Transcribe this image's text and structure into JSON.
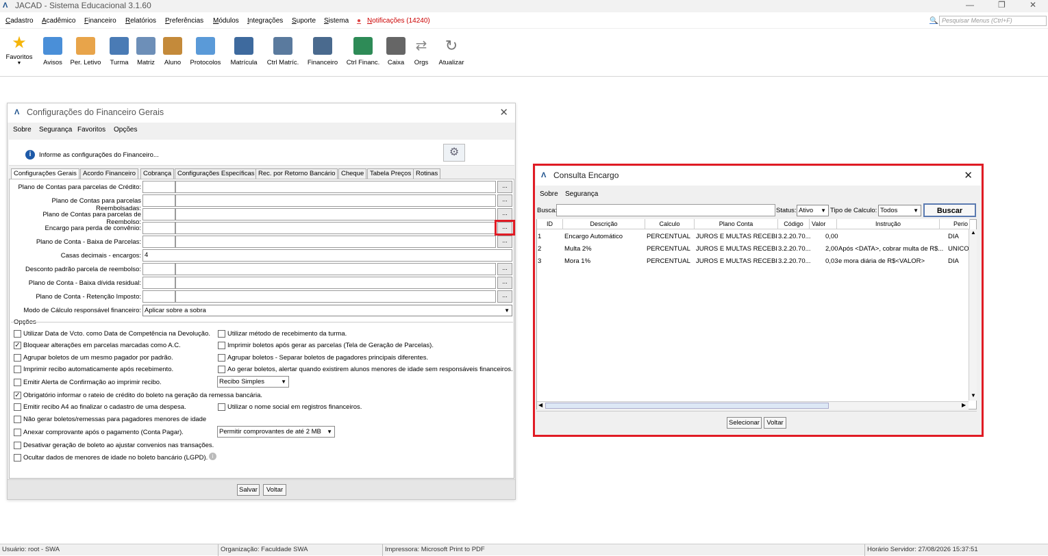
{
  "app": {
    "title": "JACAD - Sistema Educacional 3.1.60",
    "logo": "Λ"
  },
  "menubar": {
    "items": [
      "Cadastro",
      "Acadêmico",
      "Financeiro",
      "Relatórios",
      "Preferências",
      "Módulos",
      "Integrações",
      "Suporte",
      "Sistema"
    ],
    "notifications": "Notificações (14240)",
    "search_placeholder": "Pesquisar Menus (Ctrl+F)"
  },
  "toolbar": {
    "items": [
      "Favoritos",
      "Avisos",
      "Per. Letivo",
      "Turma",
      "Matriz",
      "Aluno",
      "Protocolos",
      "Matrícula",
      "Ctrl Matríc.",
      "Financeiro",
      "Ctrl Financ.",
      "Caixa",
      "Orgs",
      "Atualizar"
    ]
  },
  "config_window": {
    "title": "Configurações do Financeiro Gerais",
    "menu": [
      "Sobre",
      "Segurança",
      "Favoritos",
      "Opções"
    ],
    "info": "Informe as configurações do Financeiro...",
    "tabs": [
      "Configurações Gerais",
      "Acordo Financeiro",
      "Cobrança",
      "Configurações Específicas",
      "Rec. por Retorno Bancário",
      "Cheque",
      "Tabela Preços",
      "Rotinas"
    ],
    "fields": [
      {
        "label": "Plano de Contas para parcelas de Crédito:"
      },
      {
        "label": "Plano de Contas para parcelas Reembolsadas:"
      },
      {
        "label": "Plano de Contas para parcelas de Reembolso:"
      },
      {
        "label": "Encargo para perda de convênio:"
      },
      {
        "label": "Plano de Conta - Baixa de Parcelas:"
      },
      {
        "label": "Casas decimais - encargos:",
        "value": "4"
      },
      {
        "label": "Desconto padrão parcela de reembolso:"
      },
      {
        "label": "Plano de Conta - Baixa dívida residual:"
      },
      {
        "label": "Plano de Conta - Retenção Imposto:"
      }
    ],
    "calc_mode_label": "Modo de Cálculo responsável financeiro:",
    "calc_mode_value": "Aplicar sobre a sobra",
    "options_title": "Opções",
    "options_left": [
      {
        "label": "Utilizar Data de Vcto. como Data de Competência na Devolução.",
        "checked": false
      },
      {
        "label": "Bloquear alterações em parcelas marcadas como A.C.",
        "checked": true
      },
      {
        "label": "Agrupar boletos de um mesmo pagador por padrão.",
        "checked": false
      },
      {
        "label": "Imprimir recibo automaticamente após recebimento.",
        "checked": false
      },
      {
        "label": "Emitir Alerta de Confirmação ao imprimir recibo.",
        "checked": false
      },
      {
        "label": "Obrigatório informar o rateio de crédito do boleto na geração da remessa bancária.",
        "checked": true
      },
      {
        "label": "Emitir recibo A4 ao finalizar o cadastro de uma despesa.",
        "checked": false
      },
      {
        "label": "Não gerar boletos/remessas para pagadores menores de idade",
        "checked": false
      },
      {
        "label": "Anexar comprovante após o pagamento (Conta Pagar).",
        "checked": false
      },
      {
        "label": "Desativar geração de boleto ao ajustar convenios nas transações.",
        "checked": false
      },
      {
        "label": "Ocultar dados de menores de idade no boleto bancário (LGPD).",
        "checked": false
      }
    ],
    "options_right": [
      {
        "label": "Utilizar método de recebimento da turma.",
        "checked": false
      },
      {
        "label": "Imprimir boletos após gerar as parcelas (Tela de Geração de Parcelas).",
        "checked": false
      },
      {
        "label": "Agrupar boletos - Separar boletos de pagadores principais diferentes.",
        "checked": false
      },
      {
        "label": "Ao gerar boletos, alertar quando existirem alunos menores de idade sem responsáveis financeiros.",
        "checked": false
      },
      {
        "label": "Utilizar o nome social em registros financeiros.",
        "checked": false
      }
    ],
    "receipt_select": "Recibo Simples",
    "attach_select": "Permitir comprovantes de até 2 MB",
    "save": "Salvar",
    "back": "Voltar"
  },
  "encargo_window": {
    "title": "Consulta Encargo",
    "menu": [
      "Sobre",
      "Segurança"
    ],
    "busca_label": "Busca:",
    "status_label": "Status:",
    "status_value": "Ativo",
    "tipo_label": "Tipo de Calculo:",
    "tipo_value": "Todos",
    "search_button": "Buscar",
    "columns": [
      "ID",
      "Descrição",
      "Calculo",
      "Plano Conta",
      "Código",
      "Valor",
      "Instrução",
      "Perio"
    ],
    "rows": [
      [
        "1",
        "Encargo Automático",
        "PERCENTUAL",
        "JUROS E MULTAS RECEBI...",
        "3.2.20.70....",
        "0,00",
        "",
        "DIA"
      ],
      [
        "2",
        "Multa 2%",
        "PERCENTUAL",
        "JUROS E MULTAS RECEBI...",
        "3.2.20.70....",
        "2,00",
        "Após <DATA>, cobrar multa de R$...",
        "UNICO"
      ],
      [
        "3",
        "Mora 1%",
        "PERCENTUAL",
        "JUROS E MULTAS RECEBI...",
        "3.2.20.70....",
        "0,03",
        "e mora diária de R$<VALOR>",
        "DIA"
      ]
    ],
    "select_button": "Selecionar",
    "back_button": "Voltar",
    "highlight_color": "#e01b24"
  },
  "statusbar": {
    "user": "Usuário: root - SWA",
    "org": "Organização: Faculdade SWA",
    "printer": "Impressora: Microsoft Print to PDF",
    "server_time": "Horário Servidor: 27/08/2026 15:37:51"
  }
}
